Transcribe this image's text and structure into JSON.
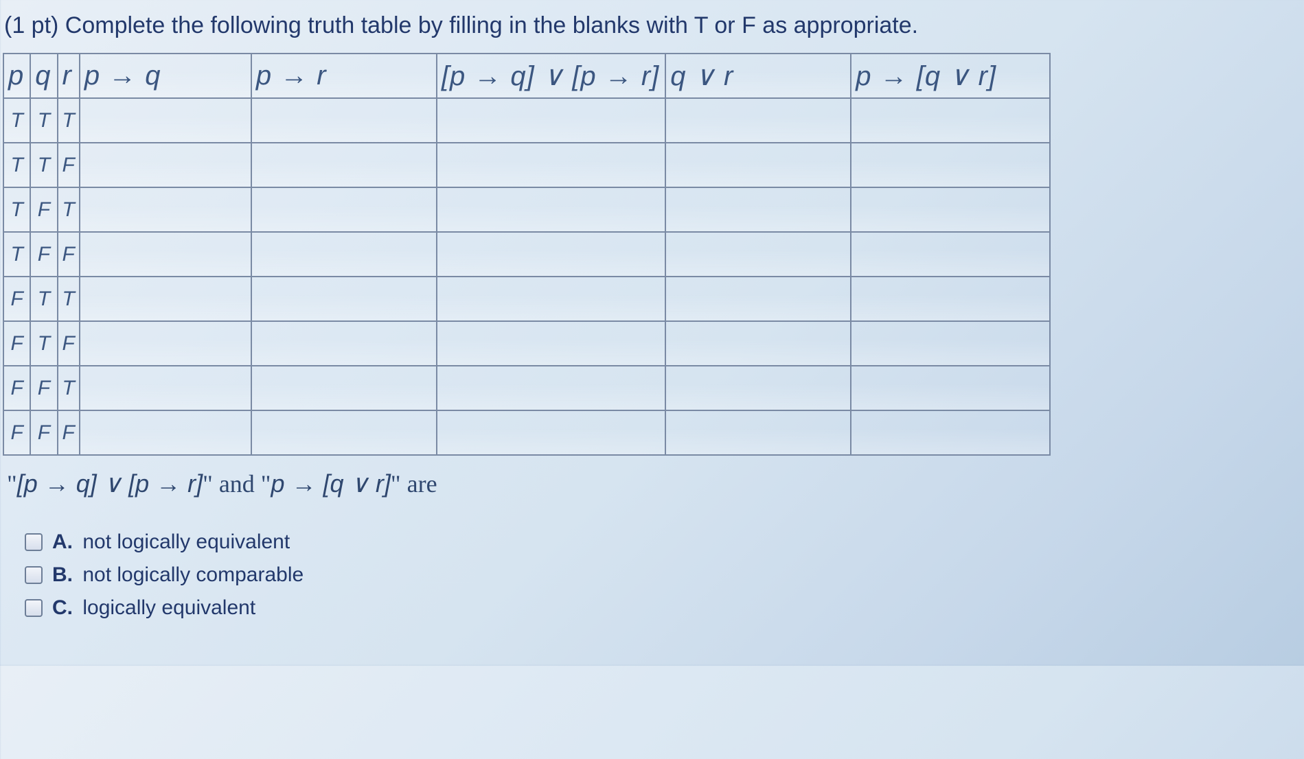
{
  "prompt": "(1 pt) Complete the following truth table by filling in the blanks with T or F as appropriate.",
  "headers": {
    "p": "p",
    "q": "q",
    "r": "r",
    "pq": "p → q",
    "pr": "p → r",
    "disj": "[p → q] ∨ [p → r]",
    "qvr": "q ∨ r",
    "last": "p → [q ∨ r]"
  },
  "rows": [
    {
      "p": "T",
      "q": "T",
      "r": "T",
      "pq": "",
      "pr": "",
      "disj": "",
      "qvr": "",
      "last": ""
    },
    {
      "p": "T",
      "q": "T",
      "r": "F",
      "pq": "",
      "pr": "",
      "disj": "",
      "qvr": "",
      "last": ""
    },
    {
      "p": "T",
      "q": "F",
      "r": "T",
      "pq": "",
      "pr": "",
      "disj": "",
      "qvr": "",
      "last": ""
    },
    {
      "p": "T",
      "q": "F",
      "r": "F",
      "pq": "",
      "pr": "",
      "disj": "",
      "qvr": "",
      "last": ""
    },
    {
      "p": "F",
      "q": "T",
      "r": "T",
      "pq": "",
      "pr": "",
      "disj": "",
      "qvr": "",
      "last": ""
    },
    {
      "p": "F",
      "q": "T",
      "r": "F",
      "pq": "",
      "pr": "",
      "disj": "",
      "qvr": "",
      "last": ""
    },
    {
      "p": "F",
      "q": "F",
      "r": "T",
      "pq": "",
      "pr": "",
      "disj": "",
      "qvr": "",
      "last": ""
    },
    {
      "p": "F",
      "q": "F",
      "r": "F",
      "pq": "",
      "pr": "",
      "disj": "",
      "qvr": "",
      "last": ""
    }
  ],
  "sentence": {
    "q1": "\"",
    "e1": "[p → q] ∨ [p → r]",
    "mid": "\" and \"",
    "e2": "p → [q ∨ r]",
    "q2": "\" are"
  },
  "options": [
    {
      "letter": "A.",
      "text": "not logically equivalent"
    },
    {
      "letter": "B.",
      "text": "not logically comparable"
    },
    {
      "letter": "C.",
      "text": "logically equivalent"
    }
  ]
}
